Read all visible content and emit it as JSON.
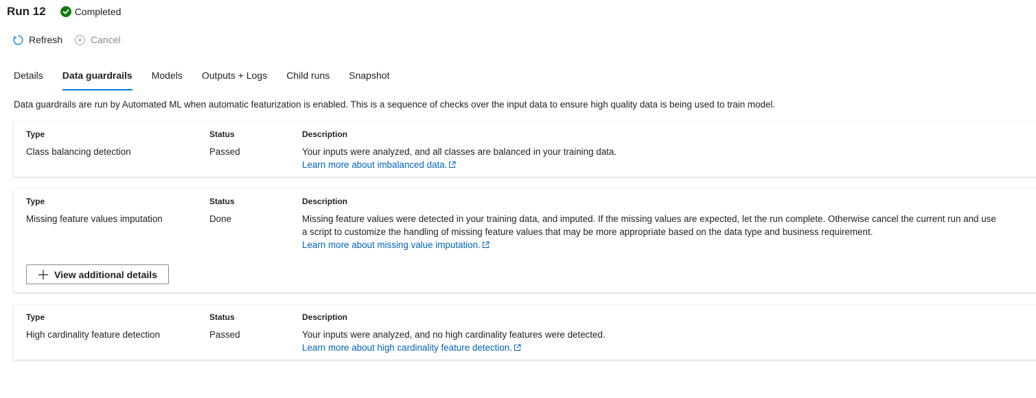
{
  "header": {
    "title": "Run 12",
    "status": "Completed",
    "status_color": "#107c10"
  },
  "commands": {
    "refresh_label": "Refresh",
    "refresh_icon": "refresh-icon",
    "cancel_label": "Cancel",
    "cancel_icon": "cancel-circle-icon"
  },
  "tabs": [
    {
      "label": "Details",
      "active": false
    },
    {
      "label": "Data guardrails",
      "active": true
    },
    {
      "label": "Models",
      "active": false
    },
    {
      "label": "Outputs + Logs",
      "active": false
    },
    {
      "label": "Child runs",
      "active": false
    },
    {
      "label": "Snapshot",
      "active": false
    }
  ],
  "intro": "Data guardrails are run by Automated ML when automatic featurization is enabled. This is a sequence of checks over the input data to ensure high quality data is being used to train model.",
  "columns": {
    "type": "Type",
    "status": "Status",
    "description": "Description"
  },
  "guardrails": [
    {
      "type": "Class balancing detection",
      "status": "Passed",
      "description": "Your inputs were analyzed, and all classes are balanced in your training data.",
      "link": "Learn more about imbalanced data."
    },
    {
      "type": "Missing feature values imputation",
      "status": "Done",
      "description_line1": "Missing feature values were detected in your training data, and imputed. If the missing values are expected, let the run complete. Otherwise cancel the current run and use",
      "description_line2": "a script to customize the handling of missing feature values that may be more appropriate based on the data type and business requirement.",
      "link": "Learn more about missing value imputation.",
      "button_label": "View additional details"
    },
    {
      "type": "High cardinality feature detection",
      "status": "Passed",
      "description": "Your inputs were analyzed, and no high cardinality features were detected.",
      "link": "Learn more about high cardinality feature detection."
    }
  ],
  "colors": {
    "accent": "#0078d4",
    "link": "#0062b8",
    "disabled": "#8a8886"
  }
}
